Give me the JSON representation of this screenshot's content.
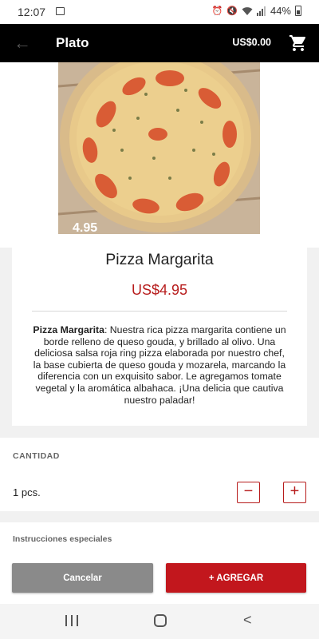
{
  "status_bar": {
    "time": "12:07",
    "battery": "44%",
    "icons": [
      "image-icon",
      "alarm-icon",
      "mute-icon",
      "wifi-icon",
      "signal-icon",
      "battery-icon"
    ]
  },
  "app_bar": {
    "title": "Plato",
    "cart_total": "US$0.00",
    "icons": [
      "back-arrow-icon",
      "shopping-cart-icon"
    ]
  },
  "dish": {
    "name": "Pizza Margarita",
    "price": "US$4.95",
    "description_name": "Pizza Margarita",
    "description_body": ": Nuestra rica pizza margarita contiene un borde relleno de queso gouda, y brillado al olivo. Una deliciosa salsa roja ring pizza elaborada por nuestro chef, la base cubierta de queso gouda y mozarela, marcando la diferencia con un exquisito sabor. Le agregamos tomate vegetal y la aromática albahaca. ¡Una delicia que cautiva nuestro paladar!",
    "photo_overlay_text": "4.95"
  },
  "quantity": {
    "label": "CANTIDAD",
    "value": "1 pcs.",
    "minus": "−",
    "plus": "+"
  },
  "instructions": {
    "label": "Instrucciones especiales"
  },
  "actions": {
    "cancel": "Cancelar",
    "add": "+ AGREGAR"
  },
  "colors": {
    "accent": "#c2171d",
    "price": "#b71c1c",
    "app_bar": "#000000",
    "cancel": "#8a8a8a"
  }
}
